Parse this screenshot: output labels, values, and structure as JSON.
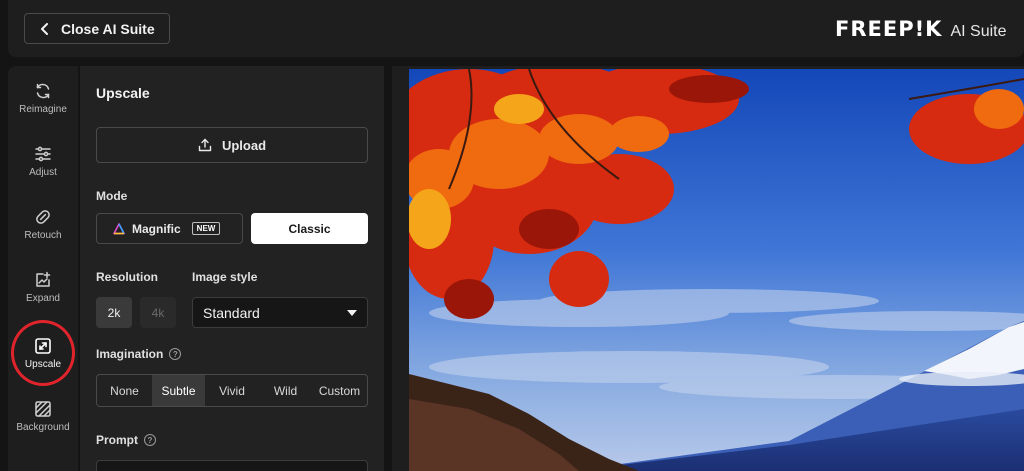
{
  "header": {
    "close_label": "Close AI Suite",
    "brand_logo": "FREEP!K",
    "brand_suffix": "AI Suite"
  },
  "rail": {
    "items": [
      {
        "label": "Reimagine",
        "icon": "refresh-icon"
      },
      {
        "label": "Adjust",
        "icon": "sliders-icon"
      },
      {
        "label": "Retouch",
        "icon": "eraser-icon"
      },
      {
        "label": "Expand",
        "icon": "expand-icon"
      },
      {
        "label": "Upscale",
        "icon": "upscale-icon",
        "active": true
      },
      {
        "label": "Background",
        "icon": "background-icon"
      }
    ]
  },
  "panel": {
    "title": "Upscale",
    "upload_label": "Upload",
    "mode_label": "Mode",
    "mode_options": {
      "magnific": "Magnific",
      "new_badge": "NEW",
      "classic": "Classic",
      "selected": "Classic"
    },
    "resolution_label": "Resolution",
    "resolution_options": [
      "2k",
      "4k"
    ],
    "resolution_selected": "2k",
    "image_style_label": "Image style",
    "image_style_value": "Standard",
    "imagination_label": "Imagination",
    "imagination_options": [
      "None",
      "Subtle",
      "Vivid",
      "Wild",
      "Custom"
    ],
    "imagination_selected": "Subtle",
    "prompt_label": "Prompt",
    "help_glyph": "?"
  },
  "colors": {
    "accent_highlight": "#e0242c",
    "panel_bg": "#222222",
    "rail_bg": "#1e1e1e"
  }
}
